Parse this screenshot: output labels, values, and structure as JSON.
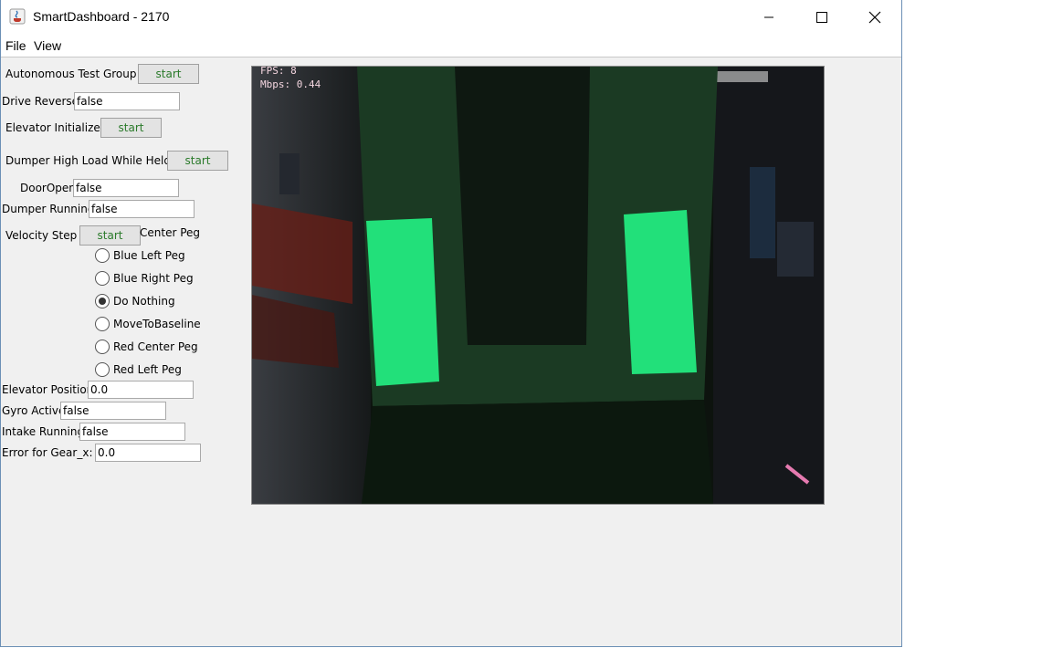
{
  "window": {
    "title": "SmartDashboard - 2170"
  },
  "menu": {
    "file": "File",
    "view": "View"
  },
  "widgets": {
    "autonomous_test_group": {
      "label": "Autonomous Test Group",
      "button": "start"
    },
    "drive_reverse": {
      "label": "Drive Reverse",
      "value": "false"
    },
    "elevator_initialize": {
      "label": "Elevator Initialize",
      "button": "start"
    },
    "dumper_high_load": {
      "label": "Dumper High Load While Held",
      "button": "start"
    },
    "door_open": {
      "label": "DoorOpen",
      "value": "false"
    },
    "dumper_running": {
      "label": "Dumper Running",
      "value": "false"
    },
    "velocity_step": {
      "label": "Velocity Step",
      "button": "start"
    },
    "autonomous_chooser": {
      "partial_label": "Center Peg",
      "options": [
        "Blue Left Peg",
        "Blue Right Peg",
        "Do Nothing",
        "MoveToBaseline",
        "Red Center Peg",
        "Red Left Peg"
      ],
      "selected": "Do Nothing"
    },
    "elevator_position": {
      "label": "Elevator Position",
      "value": "0.0"
    },
    "gyro_active": {
      "label": "Gyro Active",
      "value": "false"
    },
    "intake_running": {
      "label": "Intake Running",
      "value": "false"
    },
    "error_gear_x": {
      "label": "Error for Gear_x:",
      "value": "0.0"
    }
  },
  "camera": {
    "fps": "FPS: 8",
    "mbps": "Mbps: 0.44"
  },
  "colors": {
    "target_green": "#22e07a",
    "button_text": "#2a7a2a",
    "overlay_text": "#f4d6e0"
  }
}
